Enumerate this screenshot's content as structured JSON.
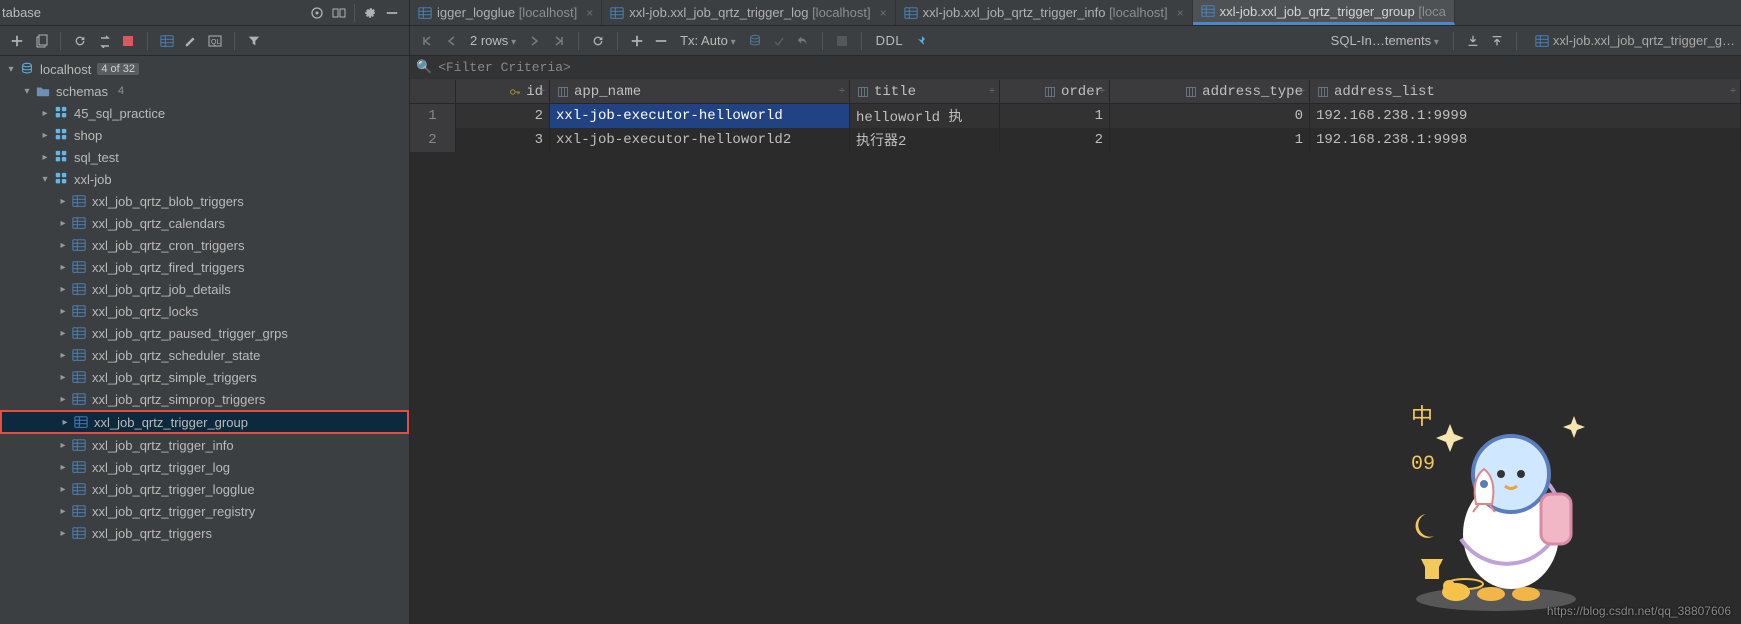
{
  "titlebar": {
    "text": "tabase"
  },
  "editor_tabs": [
    {
      "label": "igger_logglue",
      "host": "[localhost]",
      "active": false
    },
    {
      "label": "xxl-job.xxl_job_qrtz_trigger_log",
      "host": "[localhost]",
      "active": false
    },
    {
      "label": "xxl-job.xxl_job_qrtz_trigger_info",
      "host": "[localhost]",
      "active": false
    },
    {
      "label": "xxl-job.xxl_job_qrtz_trigger_group",
      "host": "[loca",
      "active": true
    }
  ],
  "ed_toolbar": {
    "rows_label": "2 rows",
    "tx_label": "Tx: Auto",
    "ddl_label": "DDL",
    "sql_label": "SQL-In…tements",
    "crumb_label": "xxl-job.xxl_job_qrtz_trigger_g…"
  },
  "filter_placeholder": "<Filter Criteria>",
  "columns": {
    "id": "id",
    "app_name": "app_name",
    "title": "title",
    "order": "order",
    "address_type": "address_type",
    "address_list": "address_list"
  },
  "rows": [
    {
      "n": "1",
      "id": "2",
      "app_name": "xxl-job-executor-helloworld",
      "title": "helloworld 执",
      "order": "1",
      "address_type": "0",
      "address_list": "192.168.238.1:9999"
    },
    {
      "n": "2",
      "id": "3",
      "app_name": "xxl-job-executor-helloworld2",
      "title": "执行器2",
      "order": "2",
      "address_type": "1",
      "address_list": "192.168.238.1:9998"
    }
  ],
  "sidebar": {
    "conn": {
      "label": "localhost",
      "count": "4 of 32"
    },
    "schemas_label": "schemas",
    "schemas_count": "4",
    "schemas": [
      {
        "name": "45_sql_practice"
      },
      {
        "name": "shop"
      },
      {
        "name": "sql_test"
      },
      {
        "name": "xxl-job"
      }
    ],
    "tables": [
      "xxl_job_qrtz_blob_triggers",
      "xxl_job_qrtz_calendars",
      "xxl_job_qrtz_cron_triggers",
      "xxl_job_qrtz_fired_triggers",
      "xxl_job_qrtz_job_details",
      "xxl_job_qrtz_locks",
      "xxl_job_qrtz_paused_trigger_grps",
      "xxl_job_qrtz_scheduler_state",
      "xxl_job_qrtz_simple_triggers",
      "xxl_job_qrtz_simprop_triggers",
      "xxl_job_qrtz_trigger_group",
      "xxl_job_qrtz_trigger_info",
      "xxl_job_qrtz_trigger_log",
      "xxl_job_qrtz_trigger_logglue",
      "xxl_job_qrtz_trigger_registry",
      "xxl_job_qrtz_triggers"
    ],
    "selected_table_index": 10
  },
  "watermark": "https://blog.csdn.net/qq_38807606"
}
